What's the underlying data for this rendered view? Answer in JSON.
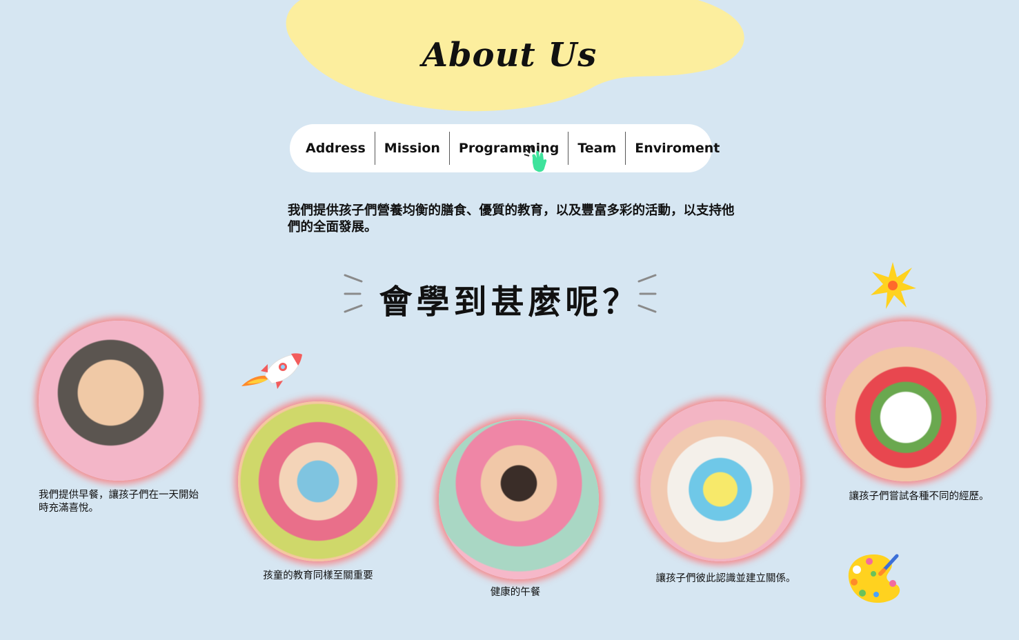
{
  "header": {
    "title": "About Us"
  },
  "nav": {
    "items": [
      {
        "label": "Address"
      },
      {
        "label": "Mission"
      },
      {
        "label": "Programming"
      },
      {
        "label": "Team"
      },
      {
        "label": "Enviroment"
      }
    ]
  },
  "intro": {
    "text": "我們提供孩子們營養均衡的膳食、優質的教育，以及豐富多彩的活動，以支持他們的全面發展。"
  },
  "learn": {
    "title": "會學到甚麼呢？"
  },
  "cards": [
    {
      "caption": "我們提供早餐，讓孩子們在一天開始時充滿喜悅。"
    },
    {
      "caption": "孩童的教育同樣至關重要"
    },
    {
      "caption": "健康的午餐"
    },
    {
      "caption": "讓孩子們彼此認識並建立關係。"
    },
    {
      "caption": "讓孩子們嘗試各種不同的經歷。"
    }
  ],
  "colors": {
    "background": "#d6e6f2",
    "title_blob": "#fcee9e",
    "nav_background": "#ffffff",
    "photo_glow": "#ff6e6e",
    "hand_icon": "#3ee39c"
  },
  "icons": [
    "hand-cursor-icon",
    "rocket-icon",
    "star-icon",
    "palette-icon"
  ]
}
